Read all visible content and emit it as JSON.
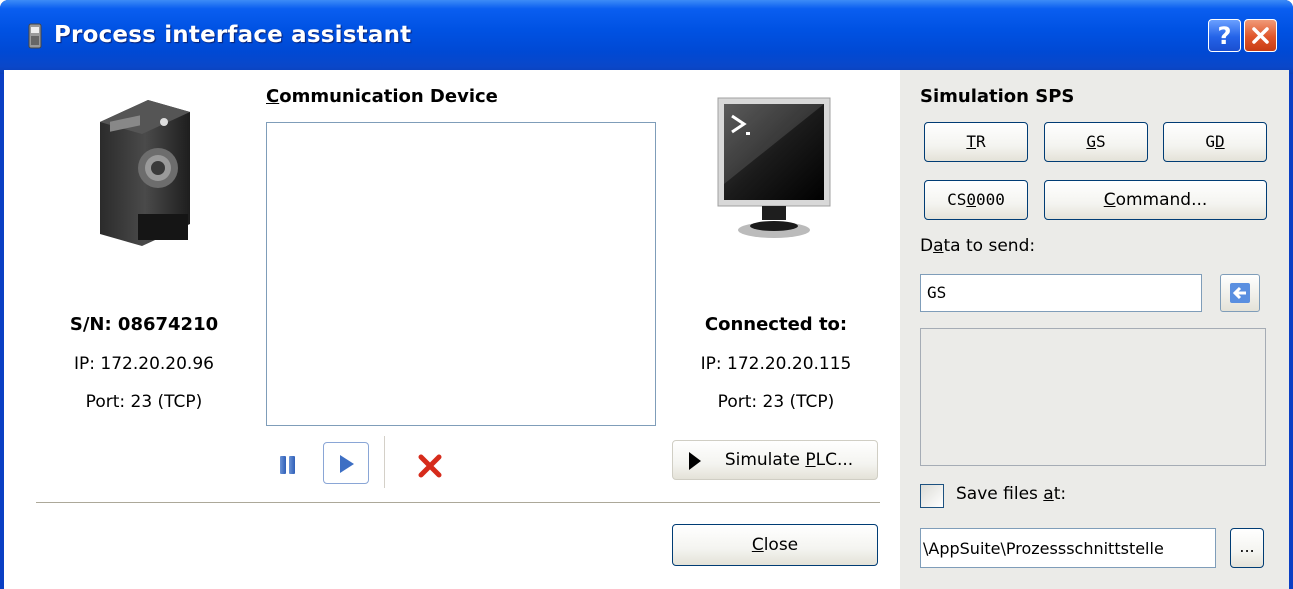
{
  "window": {
    "title": "Process interface assistant",
    "help_label": "?"
  },
  "device": {
    "serial": "S/N: 08674210",
    "ip": "IP: 172.20.20.96",
    "port": "Port: 23 (TCP)"
  },
  "communication": {
    "title_first": "C",
    "title_rest": "ommunication Device",
    "controls": {
      "pause_icon": "pause-icon",
      "play_icon": "play-icon",
      "clear_icon": "delete-x-icon"
    }
  },
  "connection": {
    "title": "Connected to:",
    "ip": "IP: 172.20.20.115",
    "port": "Port: 23 (TCP)",
    "simulate_pre": "Simulate ",
    "simulate_u": "P",
    "simulate_post": "LC..."
  },
  "footer": {
    "close_u": "C",
    "close_rest": "lose"
  },
  "simulation": {
    "title": "Simulation SPS",
    "buttons": {
      "tr_u": "T",
      "tr_rest": "R",
      "gs_u": "G",
      "gs_rest": "S",
      "gd_pre": "G",
      "gd_u": "D",
      "cs_pre": "CS",
      "cs_u": "0",
      "cs_post": "000",
      "cmd_u": "C",
      "cmd_rest": "ommand..."
    },
    "data_label_pre": "D",
    "data_label_u": "a",
    "data_label_post": "ta to send:",
    "data_value": "GS",
    "save_pre": "Save files ",
    "save_u": "a",
    "save_post": "t:",
    "save_checked": false,
    "path_value": "\\AppSuite\\Prozessschnittstelle",
    "browse_label": "..."
  },
  "colors": {
    "titlebar": "#0052e3",
    "accent_blue": "#2f5fb8",
    "delete_red": "#d62b1b"
  }
}
